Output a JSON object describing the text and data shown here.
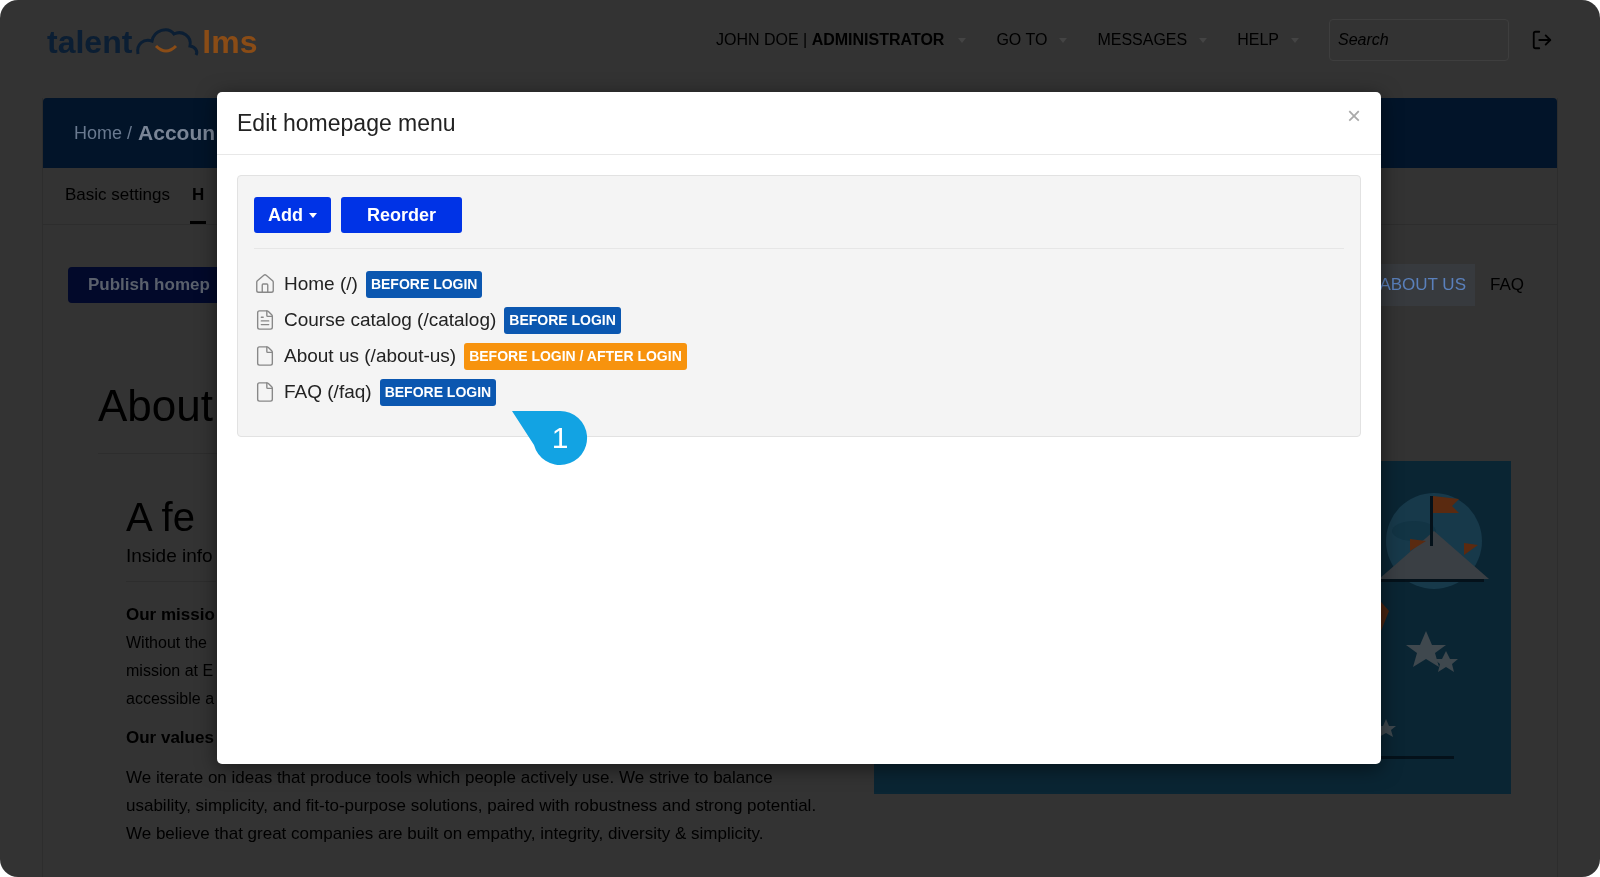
{
  "header": {
    "logo": {
      "left": "talent",
      "right": "lms"
    },
    "user": {
      "name": "JOHN DOE",
      "separator": "|",
      "role": "ADMINISTRATOR"
    },
    "menus": [
      "GO TO",
      "MESSAGES",
      "HELP"
    ],
    "search": {
      "placeholder": "Search"
    }
  },
  "page": {
    "breadcrumb": {
      "home": "Home /",
      "current": "Accoun"
    },
    "tabs": [
      {
        "label": "Basic settings",
        "selected": false
      },
      {
        "label": "H",
        "selected": true
      }
    ],
    "publish_button": "Publish homep",
    "site_nav": [
      {
        "label": "ABOUT US",
        "selected": true
      },
      {
        "label": "FAQ",
        "selected": false
      }
    ],
    "heading": "About",
    "section_title": "A fe",
    "subtitle": "Inside info",
    "mission_title": "Our missio",
    "mission_lines": [
      "Without the",
      "mission at E",
      "accessible a"
    ],
    "values_title": "Our values",
    "values_lines": [
      "We iterate on ideas that produce tools which people actively use. We strive to balance",
      "usability, simplicity, and fit-to-purpose solutions, paired with robustness and strong potential.",
      "We believe that great companies are built on empathy, integrity, diversity & simplicity."
    ],
    "illustration": {
      "kind": "picture"
    }
  },
  "modal": {
    "title": "Edit homepage menu",
    "close": "×",
    "add_button": "Add",
    "reorder_button": "Reorder",
    "items": [
      {
        "kind": "home",
        "label": "Home (/)",
        "badge": "BEFORE LOGIN",
        "color": "#0b57b0"
      },
      {
        "kind": "catalog",
        "label": "Course catalog (/catalog)",
        "badge": "BEFORE LOGIN",
        "color": "#0b57b0"
      },
      {
        "kind": "page",
        "label": "About us (/about-us)",
        "badge": "BEFORE LOGIN / AFTER LOGIN",
        "color": "#f7930e"
      },
      {
        "kind": "page",
        "label": "FAQ (/faq)",
        "badge": "BEFORE LOGIN",
        "color": "#0b57b0"
      }
    ]
  },
  "step_marker": "1"
}
